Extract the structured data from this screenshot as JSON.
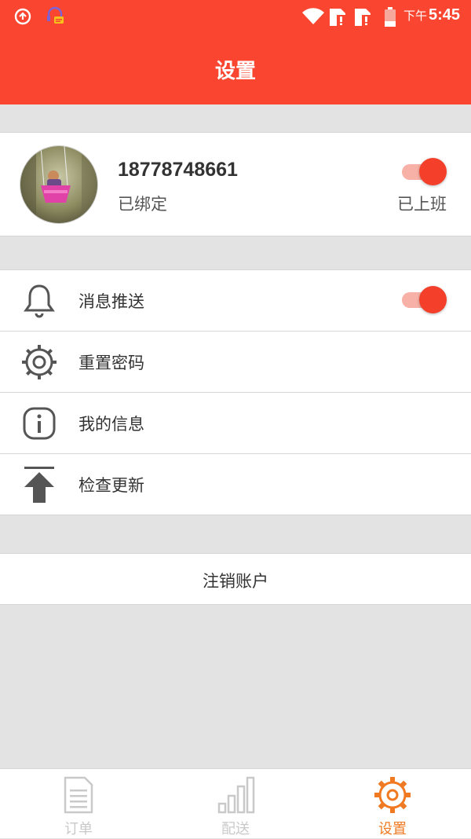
{
  "status_bar": {
    "ampm": "下午",
    "time": "5:45"
  },
  "header": {
    "title": "设置"
  },
  "profile": {
    "phone": "18778748661",
    "bind_status": "已绑定",
    "work_status": "已上班",
    "work_toggle_on": true
  },
  "menu": {
    "items": [
      {
        "label": "消息推送",
        "icon": "bell-icon",
        "toggle_on": true
      },
      {
        "label": "重置密码",
        "icon": "gear-outline-icon"
      },
      {
        "label": "我的信息",
        "icon": "info-icon"
      },
      {
        "label": "检查更新",
        "icon": "upload-arrow-icon"
      }
    ]
  },
  "logout": {
    "label": "注销账户"
  },
  "tabbar": {
    "tabs": [
      {
        "label": "订单",
        "icon": "document-icon",
        "active": false
      },
      {
        "label": "配送",
        "icon": "bar-chart-icon",
        "active": false
      },
      {
        "label": "设置",
        "icon": "settings-gear-icon",
        "active": true
      }
    ]
  },
  "colors": {
    "brand": "#fa4530",
    "toggle_knob": "#f4402b",
    "toggle_track": "#f7b1a6",
    "tab_active": "#f07a22",
    "tab_inactive": "#c9c9c9",
    "background": "#e3e3e3"
  }
}
